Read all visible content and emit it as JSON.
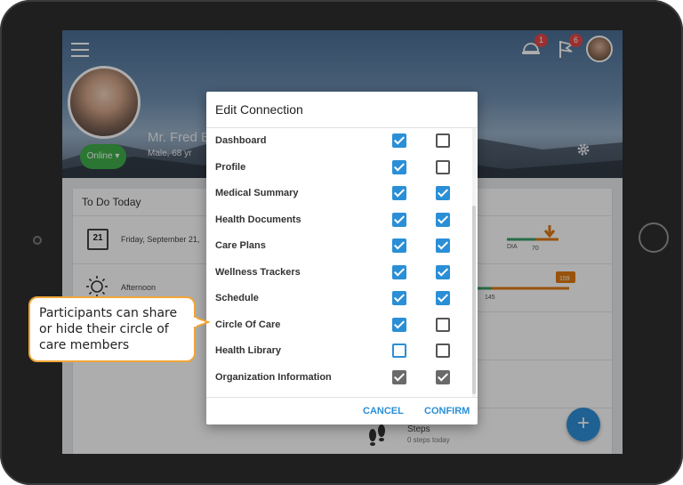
{
  "header": {
    "notification_count": "1",
    "flag_count": "6",
    "patient_name": "Mr. Fred B",
    "patient_meta": "Male, 68 yr",
    "status_button": "Online ▾"
  },
  "todo": {
    "title": "To Do Today",
    "calendar_day": "21",
    "date_text": "Friday, September 21,",
    "afternoon_text": "Afternoon"
  },
  "charts": {
    "dia_label": "DIA",
    "dia_value": "70",
    "value_159": "159",
    "value_145": "145"
  },
  "steps": {
    "title": "Steps",
    "subtitle": "0 steps today"
  },
  "fab_label": "+",
  "dialog": {
    "title": "Edit Connection",
    "rows": [
      {
        "label": "Dashboard",
        "col1": "checked",
        "col2": "unchecked"
      },
      {
        "label": "Profile",
        "col1": "checked",
        "col2": "unchecked"
      },
      {
        "label": "Medical Summary",
        "col1": "checked",
        "col2": "checked"
      },
      {
        "label": "Health Documents",
        "col1": "checked",
        "col2": "checked"
      },
      {
        "label": "Care Plans",
        "col1": "checked",
        "col2": "checked"
      },
      {
        "label": "Wellness Trackers",
        "col1": "checked",
        "col2": "checked"
      },
      {
        "label": "Schedule",
        "col1": "checked",
        "col2": "checked"
      },
      {
        "label": "Circle Of Care",
        "col1": "checked",
        "col2": "unchecked"
      },
      {
        "label": "Health Library",
        "col1": "unchecked-blue",
        "col2": "unchecked"
      },
      {
        "label": "Organization Information",
        "col1": "disabled-checked",
        "col2": "disabled-checked"
      }
    ],
    "cancel_label": "CANCEL",
    "confirm_label": "CONFIRM"
  },
  "callout": {
    "text": "Participants can share or hide their circle of care members"
  },
  "colors": {
    "accent": "#2a8fd6",
    "online": "#3fae4a",
    "callout_border": "#f0a636",
    "badge": "#e54747"
  }
}
